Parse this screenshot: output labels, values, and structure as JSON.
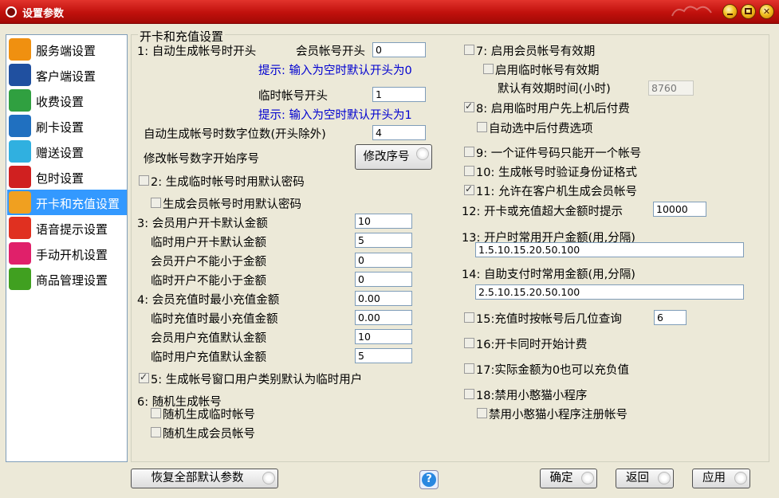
{
  "window": {
    "title": "设置参数"
  },
  "sidebar": {
    "items": [
      {
        "label": "服务端设置",
        "icon": "server-icon",
        "color": "#f09010"
      },
      {
        "label": "客户端设置",
        "icon": "monitor-icon",
        "color": "#2050a0"
      },
      {
        "label": "收费设置",
        "icon": "clock-money-icon",
        "color": "#30a040"
      },
      {
        "label": "刷卡设置",
        "icon": "card-icon",
        "color": "#2070c0"
      },
      {
        "label": "赠送设置",
        "icon": "gift-icon",
        "color": "#30b0e0"
      },
      {
        "label": "包时设置",
        "icon": "timer-icon",
        "color": "#d02020"
      },
      {
        "label": "开卡和充值设置",
        "icon": "id-card-icon",
        "color": "#f0a020"
      },
      {
        "label": "语音提示设置",
        "icon": "microphone-icon",
        "color": "#e03020"
      },
      {
        "label": "手动开机设置",
        "icon": "hand-pointer-icon",
        "color": "#e0206a"
      },
      {
        "label": "商品管理设置",
        "icon": "shopping-cart-icon",
        "color": "#40a020"
      }
    ],
    "active_index": 6
  },
  "panel": {
    "title": "开卡和充值设置"
  },
  "left": {
    "s1_label": "1: 自动生成帐号时开头",
    "member_prefix_label": "会员帐号开头",
    "member_prefix_value": "0",
    "member_hint": "提示: 输入为空时默认开头为0",
    "temp_prefix_label": "临时帐号开头",
    "temp_prefix_value": "1",
    "temp_hint": "提示: 输入为空时默认开头为1",
    "digits_label": "自动生成帐号时数字位数(开头除外)",
    "digits_value": "4",
    "modify_label": "修改帐号数字开始序号",
    "modify_button": "修改序号",
    "s2_label": "2: 生成临时帐号时用默认密码",
    "s2b_label": "生成会员帐号时用默认密码",
    "s3_label": "3: 会员用户开卡默认金额",
    "s3_value": "10",
    "temp_open_label": "临时用户开卡默认金额",
    "temp_open_value": "5",
    "member_min_label": "会员开户不能小于金额",
    "member_min_value": "0",
    "temp_min_label": "临时开户不能小于金额",
    "temp_min_value": "0",
    "s4_label": "4: 会员充值时最小充值金额",
    "s4_value": "0.00",
    "temp_recharge_min_label": "临时充值时最小充值金额",
    "temp_recharge_min_value": "0.00",
    "member_recharge_default_label": "会员用户充值默认金额",
    "member_recharge_default_value": "10",
    "temp_recharge_default_label": "临时用户充值默认金额",
    "temp_recharge_default_value": "5",
    "s5_label": "5: 生成帐号窗口用户类别默认为临时用户",
    "s6_label": "6: 随机生成帐号",
    "s6a_label": "随机生成临时帐号",
    "s6b_label": "随机生成会员帐号"
  },
  "right": {
    "s7_label": "7: 启用会员帐号有效期",
    "s7b_label": "启用临时帐号有效期",
    "validity_label": "默认有效期时间(小时)",
    "validity_value": "8760",
    "s8_label": "8: 启用临时用户先上机后付费",
    "s8b_label": "自动选中后付费选项",
    "s9_label": "9: 一个证件号码只能开一个帐号",
    "s10_label": "10: 生成帐号时验证身份证格式",
    "s11_label": "11: 允许在客户机生成会员帐号",
    "s12_label": "12: 开卡或充值超大金额时提示",
    "s12_value": "10000",
    "s13_label": "13: 开户时常用开户金额(用,分隔)",
    "s13_value": "1.5.10.15.20.50.100",
    "s14_label": "14: 自助支付时常用金额(用,分隔)",
    "s14_value": "2.5.10.15.20.50.100",
    "s15_label": "15:充值时按帐号后几位查询",
    "s15_value": "6",
    "s16_label": "16:开卡同时开始计费",
    "s17_label": "17:实际金额为0也可以充负值",
    "s18_label": "18:禁用小憨猫小程序",
    "s18b_label": "禁用小憨猫小程序注册帐号"
  },
  "checks": {
    "s2": false,
    "s2b": false,
    "s5": true,
    "s6a": false,
    "s6b": false,
    "s7": false,
    "s7b": false,
    "s8": true,
    "s8b": false,
    "s9": false,
    "s10": false,
    "s11": true,
    "s15": false,
    "s16": false,
    "s17": false,
    "s18": false,
    "s18b": false
  },
  "footer": {
    "restore_button": "恢复全部默认参数",
    "help_glyph": "?",
    "ok_button": "确定",
    "back_button": "返回",
    "apply_button": "应用"
  },
  "colors": {
    "titlebar": "#c0100c",
    "selection": "#3399ff",
    "hint": "#0000d0",
    "background": "#ece9d8"
  }
}
